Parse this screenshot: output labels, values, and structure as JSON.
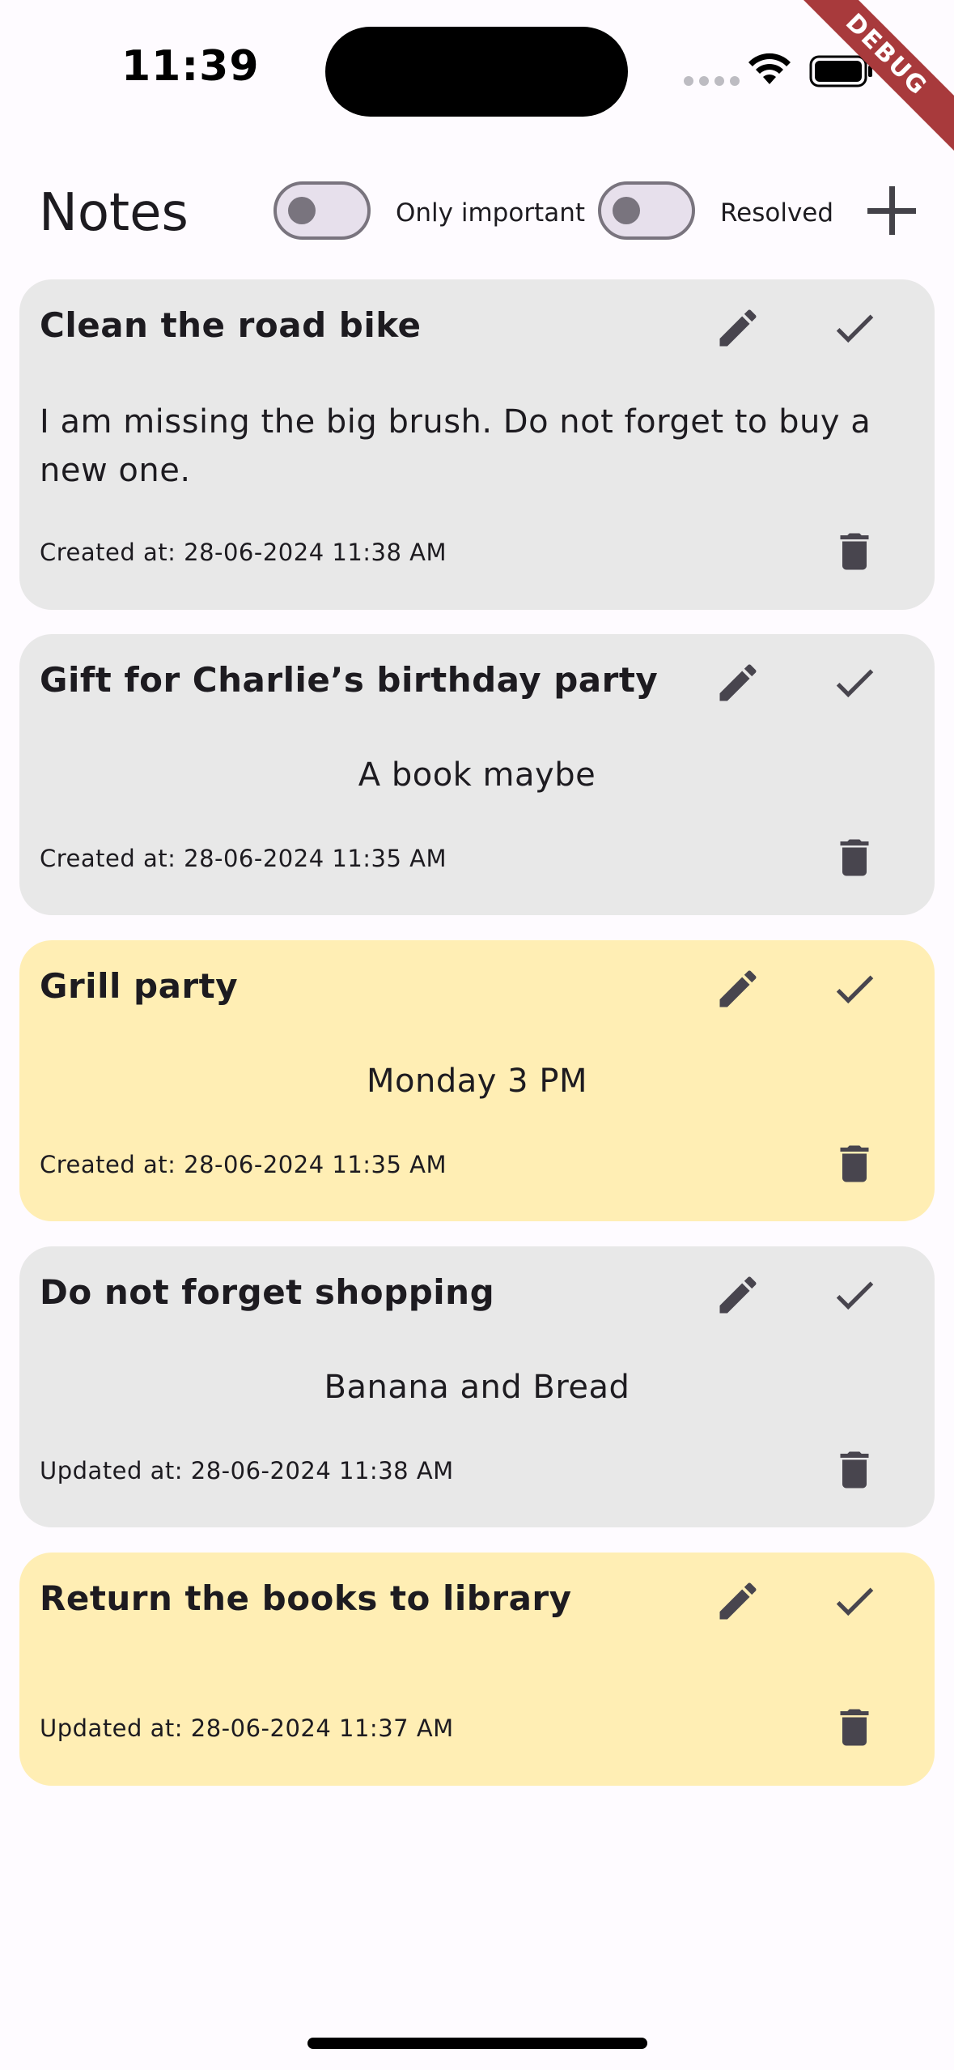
{
  "status_bar": {
    "time": "11:39",
    "debug_label": "DEBUG"
  },
  "app_bar": {
    "title": "Notes",
    "only_important_label": "Only important",
    "resolved_label": "Resolved",
    "only_important_on": false,
    "resolved_on": false,
    "add_icon": "plus-icon"
  },
  "notes": [
    {
      "title": "Clean the road bike",
      "body": "I am missing the big brush. Do not forget to buy a new one.",
      "date": "Created at: 28-06-2024 11:38 AM",
      "important": false
    },
    {
      "title": "Gift for Charlie’s birthday party",
      "body": "A book maybe",
      "date": "Created at: 28-06-2024 11:35 AM",
      "important": false
    },
    {
      "title": "Grill party",
      "body": "Monday 3 PM",
      "date": "Created at: 28-06-2024 11:35 AM",
      "important": true
    },
    {
      "title": "Do not forget shopping",
      "body": "Banana and Bread",
      "date": "Updated at: 28-06-2024 11:38 AM",
      "important": false
    },
    {
      "title": "Return the books to library",
      "body": "",
      "date": "Updated at: 28-06-2024 11:37 AM",
      "important": true
    }
  ],
  "colors": {
    "card_default": "#e8e8e8",
    "card_important": "#ffeeb4",
    "icon": "#48454e",
    "background": "#fefbff"
  },
  "icons": {
    "edit": "pencil-icon",
    "resolve": "check-icon",
    "delete": "trash-icon"
  }
}
